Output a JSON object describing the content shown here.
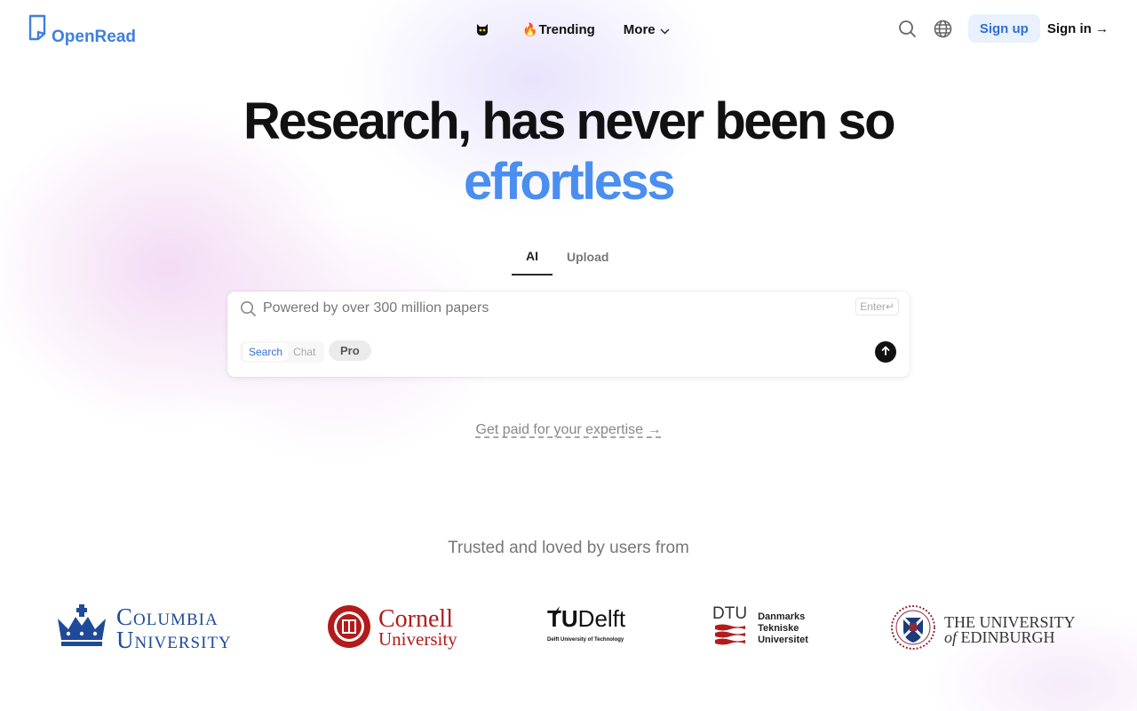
{
  "header": {
    "brand": "OpenRead",
    "nav": {
      "trending_icon": "🔥",
      "trending": "Trending",
      "more": "More"
    },
    "sign_up": "Sign up",
    "sign_in": "Sign in →"
  },
  "hero": {
    "headline_line1": "Research, has never been so",
    "headline_line2": "effortless",
    "accent_color": "#4a8ef0"
  },
  "tabs": [
    {
      "label": "AI",
      "active": true
    },
    {
      "label": "Upload",
      "active": false
    }
  ],
  "search": {
    "placeholder": "Powered by over 300 million papers",
    "enter_hint": "Enter↵",
    "modes": [
      {
        "label": "Search",
        "active": true
      },
      {
        "label": "Chat",
        "active": false
      }
    ],
    "pro": "Pro"
  },
  "cta": "Get paid for your expertise →",
  "trusted": {
    "heading": "Trusted and loved by users from",
    "universities": {
      "columbia": {
        "line1": "Columbia",
        "line2": "University"
      },
      "cornell": {
        "line1": "Cornell",
        "line2": "University"
      },
      "tudelft": {
        "tu": "TU",
        "delft": "Delft",
        "sub": "Delft University of Technology"
      },
      "dtu": {
        "mark": "DTU",
        "line1": "Danmarks",
        "line2": "Tekniske",
        "line3": "Universitet"
      },
      "edinburgh": {
        "line1": "THE UNIVERSITY",
        "of": "of",
        "line2": "EDINBURGH"
      }
    }
  },
  "icons": {
    "brand_logo": "openread-logo-icon",
    "mascot": "mascot-icon",
    "search": "search-icon",
    "globe": "globe-icon",
    "submit": "arrow-up-icon"
  }
}
